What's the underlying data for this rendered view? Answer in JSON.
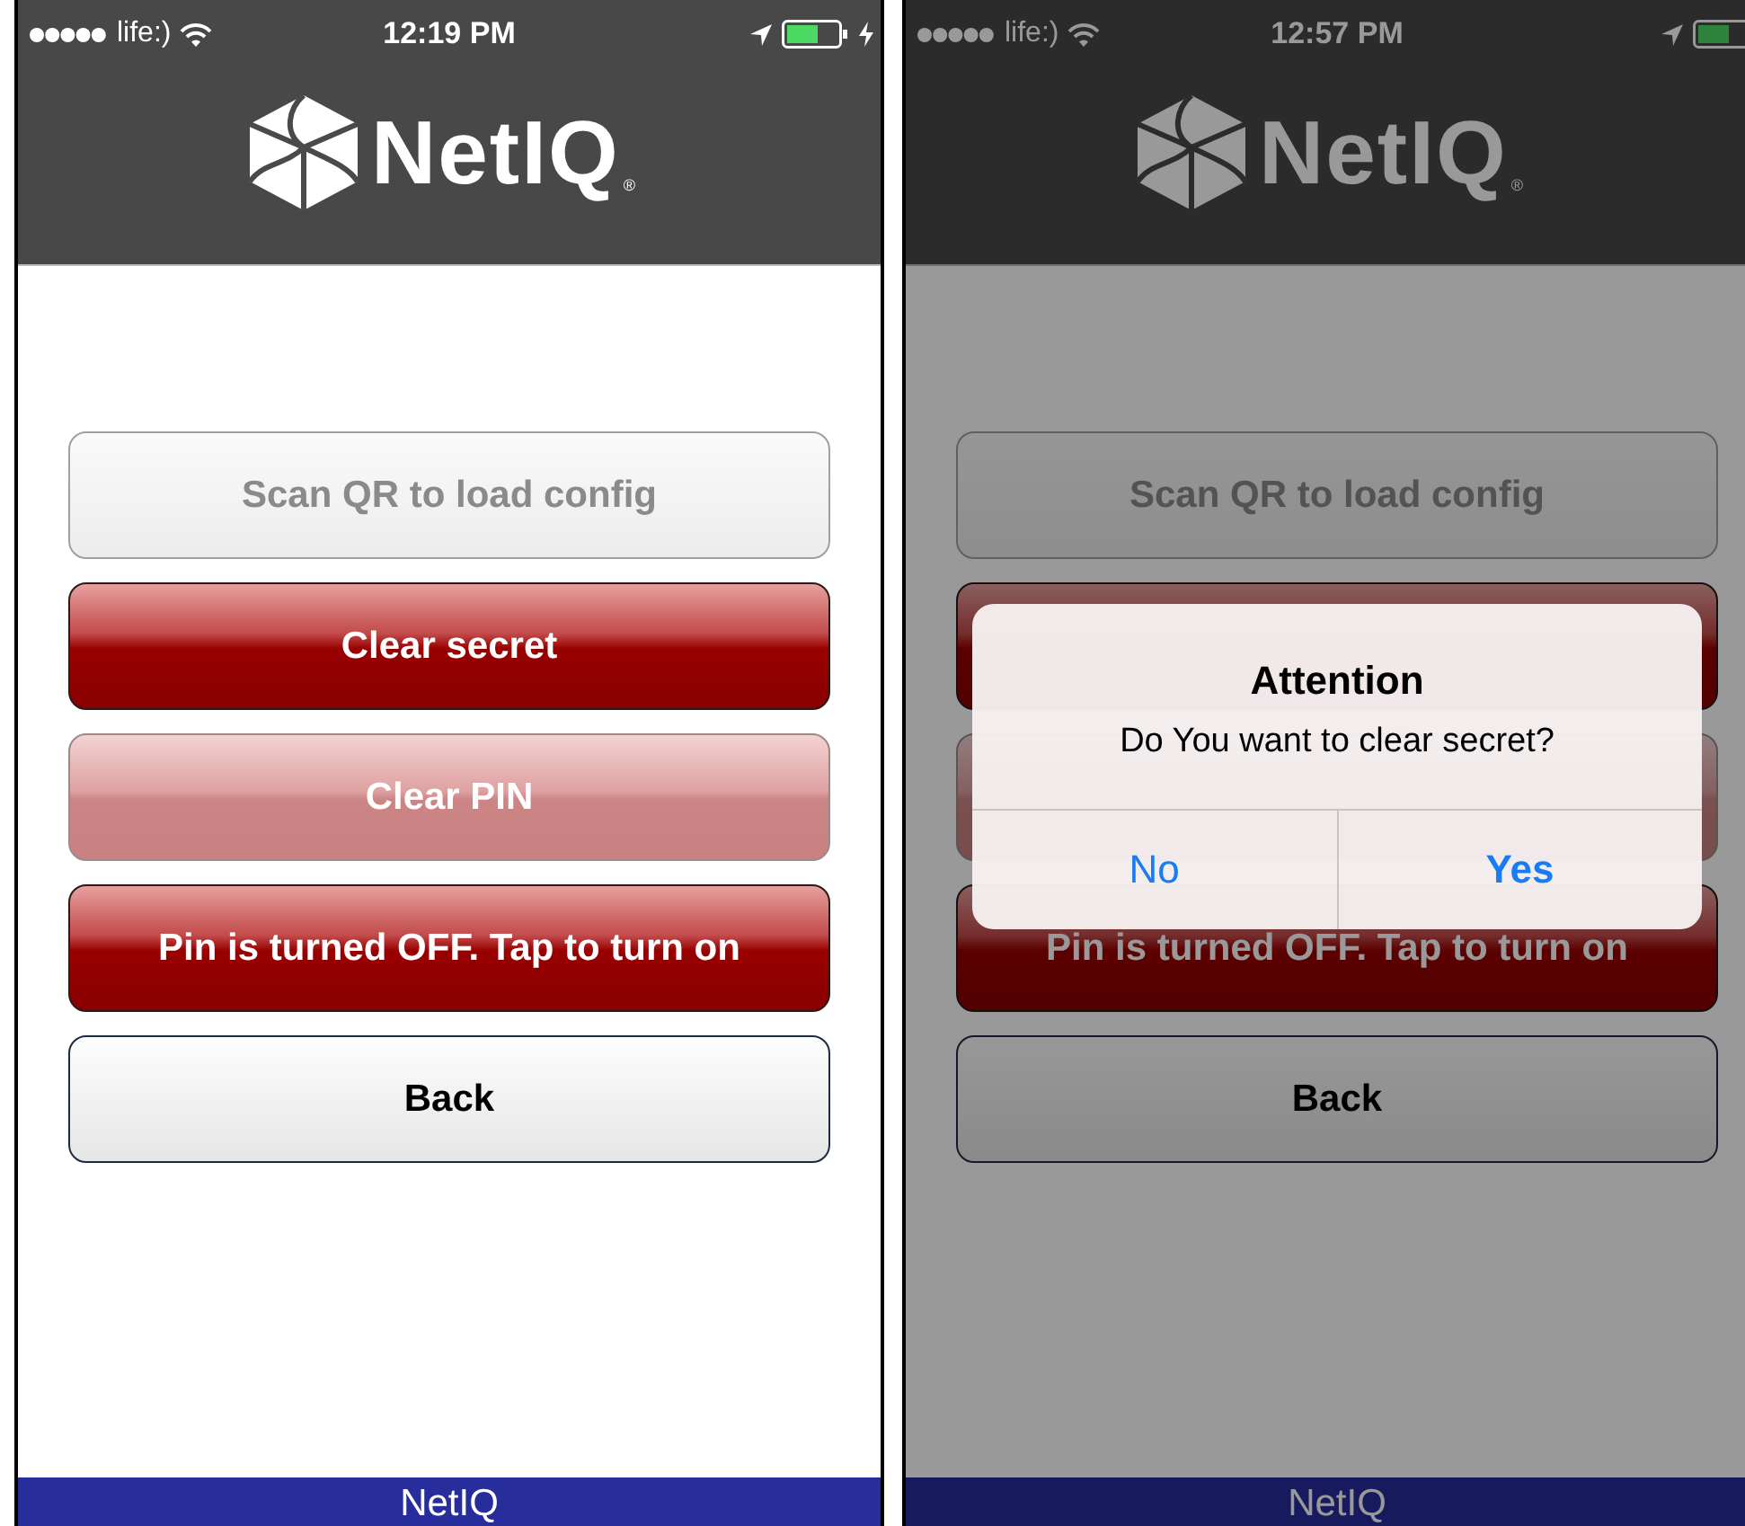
{
  "screens": [
    {
      "status_bar": {
        "carrier": "life:)",
        "time": "12:19 PM",
        "charging": true
      },
      "logo": {
        "text": "NetIQ",
        "mark": "®"
      },
      "buttons": [
        {
          "label": "Scan QR to load config",
          "kind": "plain",
          "disabled": true
        },
        {
          "label": "Clear secret",
          "kind": "danger",
          "disabled": false
        },
        {
          "label": "Clear PIN",
          "kind": "danger",
          "disabled": true
        },
        {
          "label": "Pin is turned OFF. Tap to turn on",
          "kind": "danger",
          "disabled": false
        },
        {
          "label": "Back",
          "kind": "plain",
          "disabled": false
        }
      ],
      "footer": "NetIQ"
    },
    {
      "status_bar": {
        "carrier": "life:)",
        "time": "12:57 PM"
      },
      "logo": {
        "text": "NetIQ",
        "mark": "®"
      },
      "buttons": [
        {
          "label": "Scan QR to load config",
          "kind": "plain",
          "disabled": true
        },
        {
          "kind": "danger",
          "disabled": false
        },
        {
          "kind": "danger",
          "disabled": true
        },
        {
          "label": "Pin is turned OFF. Tap to turn on",
          "kind": "danger",
          "disabled": false
        },
        {
          "label": "Back",
          "kind": "plain",
          "disabled": false
        }
      ],
      "footer": "NetIQ",
      "dialog": {
        "title": "Attention",
        "message": "Do You want to clear secret?",
        "buttons": [
          {
            "label": "No",
            "primary": false
          },
          {
            "label": "Yes",
            "primary": true
          }
        ]
      }
    }
  ]
}
